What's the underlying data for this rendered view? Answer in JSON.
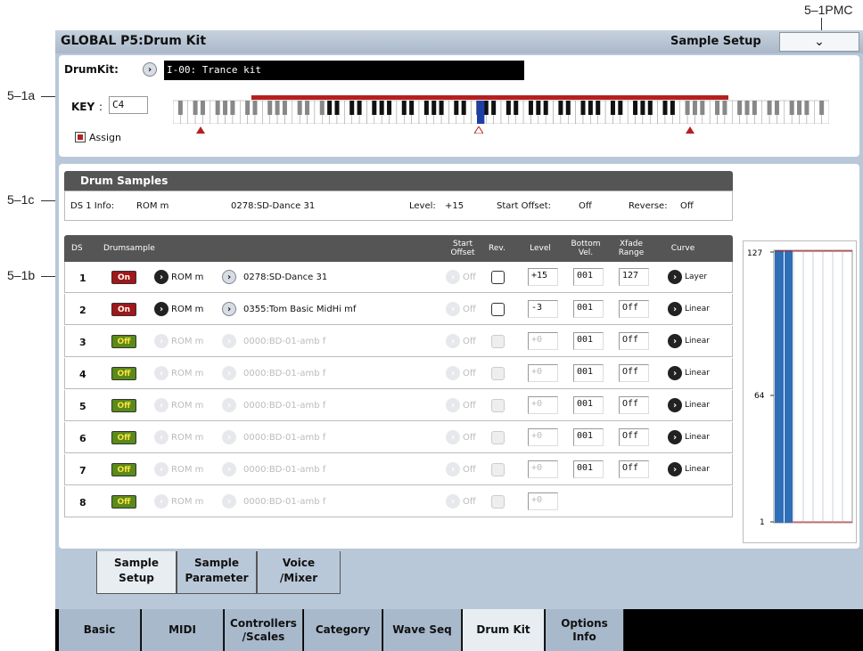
{
  "callouts": {
    "c_1a": "5–1a",
    "c_1b": "5–1b",
    "c_1c": "5–1c",
    "c_pmc": "5–1PMC"
  },
  "header": {
    "title": "GLOBAL P5:Drum Kit",
    "page": "Sample Setup",
    "menu_icon": "chevron-down-icon"
  },
  "drumkit": {
    "label": "DrumKit:",
    "value": "I-00: Trance kit"
  },
  "key": {
    "label": "KEY",
    "separator": ":",
    "value": "C4"
  },
  "assign": {
    "label": "Assign",
    "checked": true,
    "color": "#b42020"
  },
  "drum_samples": {
    "header": "Drum Samples",
    "info_label": "DS 1 Info:",
    "bank": "ROM m",
    "sample": "0278:SD-Dance 31",
    "level_label": "Level:",
    "level": "+15",
    "start_offset_label": "Start Offset:",
    "start_offset": "Off",
    "reverse_label": "Reverse:",
    "reverse": "Off"
  },
  "table": {
    "columns": {
      "ds": "DS",
      "drumsample": "Drumsample",
      "start_offset": "Start\nOffset",
      "rev": "Rev.",
      "level": "Level",
      "bottom_vel": "Bottom\nVel.",
      "xfade": "Xfade\nRange",
      "curve": "Curve"
    }
  },
  "rows": [
    {
      "num": "1",
      "sw": "On",
      "bank": "ROM m",
      "sample": "0278:SD-Dance 31",
      "so": "Off",
      "level": "+15",
      "bv": "001",
      "xr": "127",
      "curve": "Layer"
    },
    {
      "num": "2",
      "sw": "On",
      "bank": "ROM m",
      "sample": "0355:Tom Basic MidHi mf",
      "so": "Off",
      "level": "-3",
      "bv": "001",
      "xr": "Off",
      "curve": "Linear"
    },
    {
      "num": "3",
      "sw": "Off",
      "bank": "ROM m",
      "sample": "0000:BD-01-amb  f",
      "so": "Off",
      "level": "+0",
      "bv": "001",
      "xr": "Off",
      "curve": "Linear"
    },
    {
      "num": "4",
      "sw": "Off",
      "bank": "ROM m",
      "sample": "0000:BD-01-amb  f",
      "so": "Off",
      "level": "+0",
      "bv": "001",
      "xr": "Off",
      "curve": "Linear"
    },
    {
      "num": "5",
      "sw": "Off",
      "bank": "ROM m",
      "sample": "0000:BD-01-amb  f",
      "so": "Off",
      "level": "+0",
      "bv": "001",
      "xr": "Off",
      "curve": "Linear"
    },
    {
      "num": "6",
      "sw": "Off",
      "bank": "ROM m",
      "sample": "0000:BD-01-amb  f",
      "so": "Off",
      "level": "+0",
      "bv": "001",
      "xr": "Off",
      "curve": "Linear"
    },
    {
      "num": "7",
      "sw": "Off",
      "bank": "ROM m",
      "sample": "0000:BD-01-amb  f",
      "so": "Off",
      "level": "+0",
      "bv": "001",
      "xr": "Off",
      "curve": "Linear"
    },
    {
      "num": "8",
      "sw": "Off",
      "bank": "ROM m",
      "sample": "0000:BD-01-amb  f",
      "so": "Off",
      "level": "+0",
      "bv": "",
      "xr": "",
      "curve": ""
    }
  ],
  "velocity_graph": {
    "ticks": [
      "127",
      "64",
      "1"
    ]
  },
  "sub_tabs": [
    "Sample\nSetup",
    "Sample\nParameter",
    "Voice\n/Mixer"
  ],
  "main_tabs": [
    "Basic",
    "MIDI",
    "Controllers\n/Scales",
    "Category",
    "Wave Seq",
    "Drum Kit",
    "Options\nInfo"
  ],
  "colors": {
    "screen_bg": "#b9c8d8",
    "on": "#a01818",
    "off": "#5a8a1a",
    "accent_blue": "#2f6fb8"
  }
}
